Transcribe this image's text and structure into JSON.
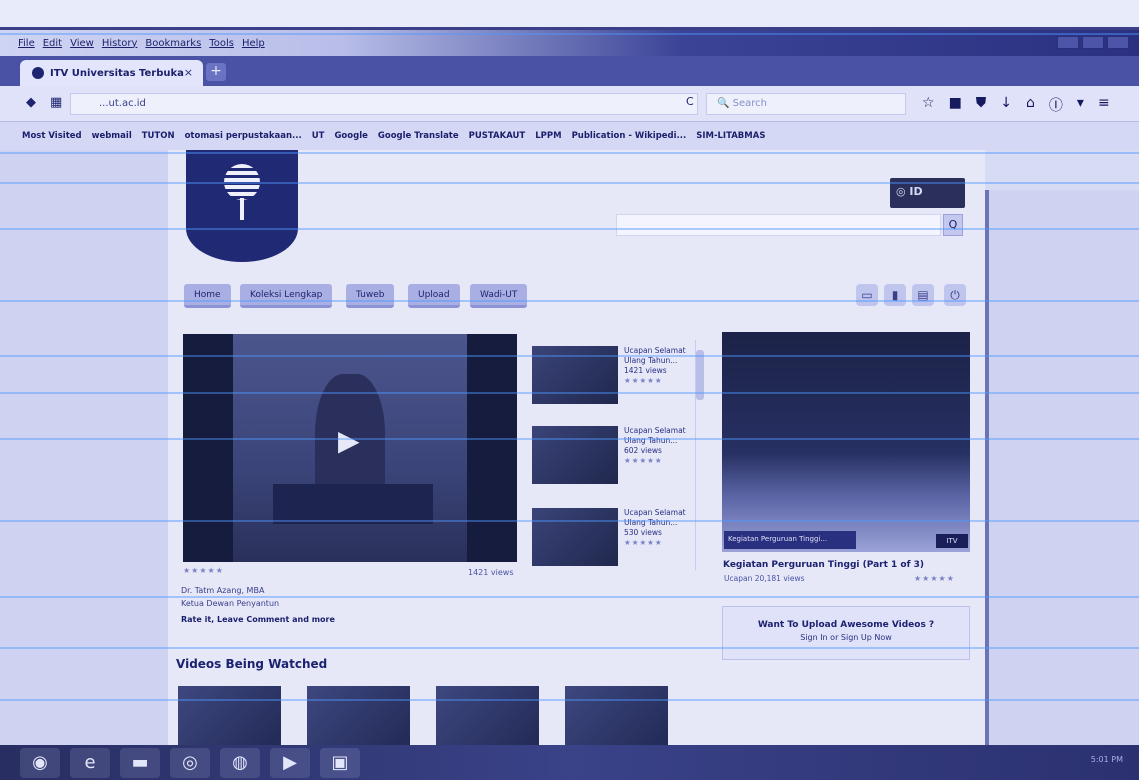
{
  "window": {
    "menu": [
      "File",
      "Edit",
      "View",
      "History",
      "Bookmarks",
      "Tools",
      "Help"
    ]
  },
  "tab": {
    "title": "ITV Universitas Terbuka",
    "close": "×",
    "new": "+"
  },
  "navbar": {
    "url": "...ut.ac.id",
    "search_placeholder": "Search",
    "back": "◆",
    "reload": "C"
  },
  "bookmarks": [
    "Most Visited",
    "webmail",
    "TUTON",
    "otomasi perpustakaan...",
    "UT",
    "Google",
    "Google Translate",
    "PUSTAKAUT",
    "LPPM",
    "Publication - Wikipedi...",
    "SIM-LITABMAS"
  ],
  "site": {
    "lang_badge": "◎ ID",
    "search_button": "Q",
    "nav_tabs": [
      "Home",
      "Koleksi Lengkap",
      "Tuweb",
      "Upload",
      "Wadi-UT"
    ],
    "right_icons": [
      "tv-icon",
      "mic-icon",
      "calendar-icon",
      "power-icon"
    ]
  },
  "featured": {
    "stars": "★★★★★",
    "views": "1421 views",
    "name": "Dr. Tatm Azang, MBA",
    "role": "Ketua Dewan Penyantun",
    "action": "Rate it, Leave Comment and more"
  },
  "video_list": [
    {
      "title": "Ucapan Selamat Ulang Tahun...",
      "views": "1421 views",
      "stars": "★★★★★"
    },
    {
      "title": "Ucapan Selamat Ulang Tahun...",
      "views": "602 views",
      "stars": "★★★★★"
    },
    {
      "title": "Ucapan Selamat Ulang Tahun...",
      "views": "530 views",
      "stars": "★★★★★"
    }
  ],
  "right_video": {
    "caption": "Kegiatan Perguruan Tinggi...",
    "badge": "ITV",
    "title": "Kegiatan Perguruan Tinggi (Part 1 of 3)",
    "meta": "Ucapan   20,181 views",
    "stars": "★★★★★"
  },
  "upload_box": {
    "title": "Want To Upload Awesome Videos ?",
    "link": "Sign In or Sign Up Now"
  },
  "section": {
    "title": "Videos Being Watched"
  },
  "taskbar": {
    "clock": "5:01 PM"
  }
}
